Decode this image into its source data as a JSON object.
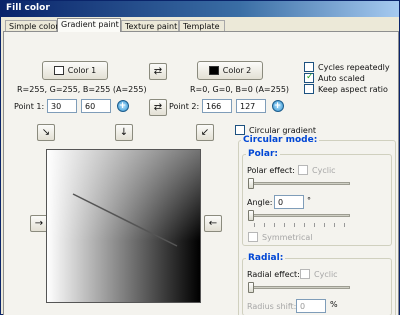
{
  "window": {
    "title": "Fill color"
  },
  "tabs": [
    {
      "label": "Simple color"
    },
    {
      "label": "Gradient paint"
    },
    {
      "label": "Texture paint"
    },
    {
      "label": "Template"
    }
  ],
  "color1": {
    "label": "Color 1",
    "swatch": "#ffffff",
    "rgba": "R=255, G=255, B=255 (A=255)",
    "point_label": "Point 1:",
    "x": "30",
    "y": "60"
  },
  "color2": {
    "label": "Color 2",
    "swatch": "#000000",
    "rgba": "R=0, G=0, B=0 (A=255)",
    "point_label": "Point 2:",
    "x": "166",
    "y": "127"
  },
  "options": {
    "cycles_repeatedly": {
      "label": "Cycles repeatedly",
      "checked": false
    },
    "auto_scaled": {
      "label": "Auto scaled",
      "checked": true
    },
    "keep_aspect_ratio": {
      "label": "Keep aspect ratio",
      "checked": false
    },
    "circular_gradient": {
      "label": "Circular gradient",
      "checked": false
    }
  },
  "circular_mode": {
    "title": "Circular mode:",
    "polar": {
      "title": "Polar:",
      "effect_label": "Polar effect:",
      "cyclic_label": "Cyclic",
      "angle_label": "Angle:",
      "angle_value": "0",
      "angle_unit": "°",
      "symmetrical_label": "Symmetrical"
    },
    "radial": {
      "title": "Radial:",
      "effect_label": "Radial effect:",
      "cyclic_label": "Cyclic",
      "shift_label": "Radius shift:",
      "shift_value": "0",
      "shift_unit": "%"
    }
  },
  "arrows": {
    "top_left": "↘",
    "top_center": "↓",
    "top_right": "↙",
    "left": "→",
    "right": "←",
    "swap": "⇄",
    "add": "+"
  }
}
